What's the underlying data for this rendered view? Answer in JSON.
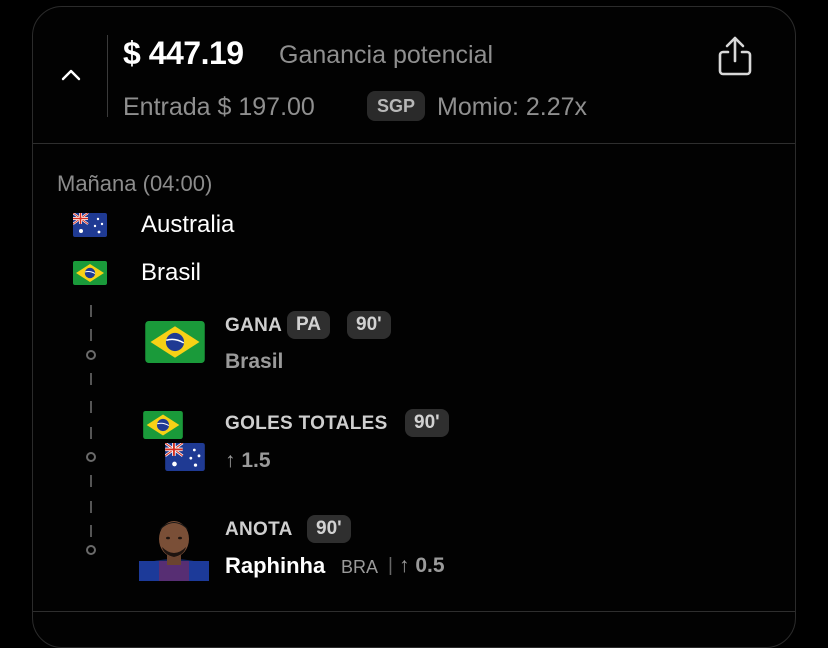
{
  "header": {
    "payout": "$ 447.19",
    "payout_label": "Ganancia potencial",
    "stake": "Entrada $ 197.00",
    "sgp_badge": "SGP",
    "odds": "Momio: 2.27x"
  },
  "event": {
    "date": "Mañana (04:00)",
    "teams": [
      "Australia",
      "Brasil"
    ]
  },
  "legs": [
    {
      "title": "GANA",
      "chips": [
        "PA",
        "90'"
      ],
      "subtitle": "Brasil"
    },
    {
      "title": "GOLES TOTALES",
      "chips": [
        "90'"
      ],
      "subtitle": "↑ 1.5"
    },
    {
      "title": "ANOTA",
      "chips": [
        "90'"
      ],
      "player": "Raphinha",
      "team": "BRA",
      "separator": "|",
      "line": "↑ 0.5"
    }
  ],
  "colors": {
    "brazil_green": "#1a9a3a",
    "brazil_yellow": "#f7d116",
    "australia_blue": "#1f3a93"
  }
}
